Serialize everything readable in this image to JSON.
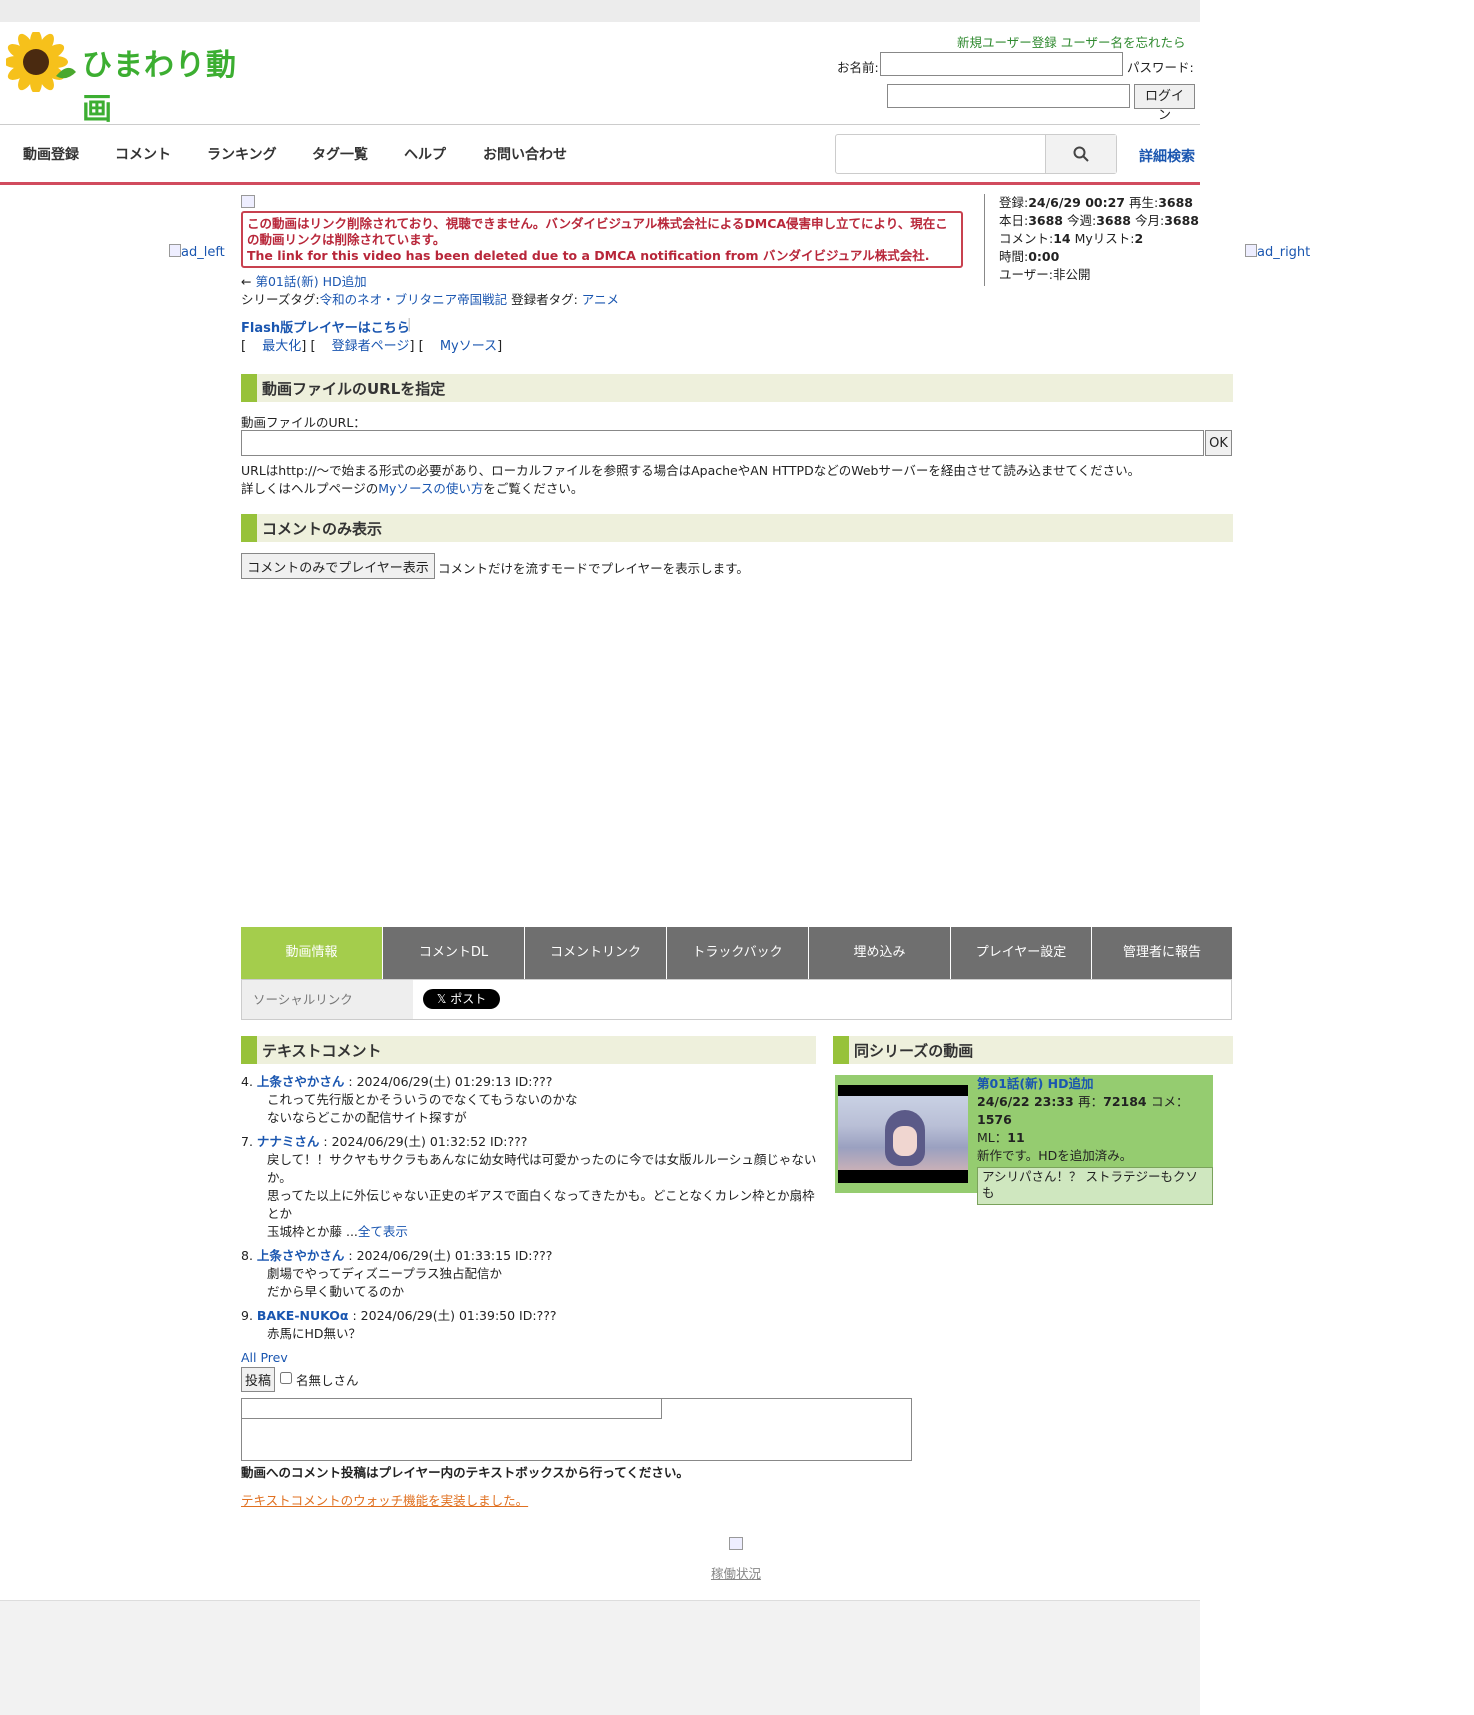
{
  "site": {
    "logo_text": "ひまわり動画"
  },
  "header": {
    "register_link": "新規ユーザー登録",
    "forgot_link": "ユーザー名を忘れたら",
    "name_label": "お名前:",
    "password_label": "パスワード:",
    "login_button": "ログイン"
  },
  "nav": {
    "items": [
      "動画登録",
      "コメント",
      "ランキング",
      "タグ一覧",
      "ヘルプ",
      "お問い合わせ"
    ],
    "detail_search": "詳細検索"
  },
  "ads": {
    "left": "ad_left",
    "right": "ad_right"
  },
  "warning": {
    "ja": "この動画はリンク削除されており、視聴できません。バンダイビジュアル株式会社によるDMCA侵害申し立てにより、現在この動画リンクは削除されています。",
    "en": "The link for this video has been deleted due to a DMCA notification from バンダイビジュアル株式会社."
  },
  "video": {
    "prev_arrow": "←",
    "prev_link": "第01話(新) HD追加",
    "series_tag_label": "シリーズタグ:",
    "series_tag": "令和のネオ・ブリタニア帝国戦記",
    "user_tag_label": "登録者タグ:",
    "user_tag": "アニメ",
    "flash_link": "Flash版プレイヤーはこちら",
    "maximize": "最大化",
    "uploader_page": "登録者ページ",
    "my_source": "Myソース"
  },
  "stats": {
    "registered_label": "登録:",
    "registered": "24/6/29 00:27",
    "plays_label": "再生:",
    "plays": "3688",
    "today_label": "本日:",
    "today": "3688",
    "week_label": "今週:",
    "week": "3688",
    "month_label": "今月:",
    "month": "3688",
    "comments_label": "コメント:",
    "comments": "14",
    "mylist_label": "Myリスト:",
    "mylist": "2",
    "time_label": "時間:",
    "time": "0:00",
    "user_label": "ユーザー:非公開"
  },
  "url_section": {
    "title": "動画ファイルのURLを指定",
    "field_label": "動画ファイルのURL：",
    "ok": "OK",
    "note1": "URLはhttp://〜で始まる形式の必要があり、ローカルファイルを参照する場合はApacheやAN HTTPDなどのWebサーバーを経由させて読み込ませてください。",
    "note2_pre": "詳しくはヘルプページの",
    "note2_link": "Myソースの使い方",
    "note2_post": "をご覧ください。"
  },
  "comment_only": {
    "title": "コメントのみ表示",
    "button": "コメントのみでプレイヤー表示",
    "desc": "コメントだけを流すモードでプレイヤーを表示します。"
  },
  "tabs": [
    "動画情報",
    "コメントDL",
    "コメントリンク",
    "トラックバック",
    "埋め込み",
    "プレイヤー設定",
    "管理者に報告"
  ],
  "social": {
    "label": "ソーシャルリンク",
    "x_post": "𝕏 ポスト"
  },
  "text_comments": {
    "title": "テキストコメント",
    "items": [
      {
        "num": "4.",
        "name": "上条さやかさん",
        "meta": ": 2024/06/29(土) 01:29:13 ID:???",
        "lines": [
          "これって先行版とかそういうのでなくてもうないのかな",
          "ないならどこかの配信サイト探すが"
        ]
      },
      {
        "num": "7.",
        "name": "ナナミさん",
        "meta": ": 2024/06/29(土) 01:32:52 ID:???",
        "lines": [
          "戻して！！サクヤもサクラもあんなに幼女時代は可愛かったのに今では女版ルルーシュ顔じゃないか。",
          "思ってた以上に外伝じゃない正史のギアスで面白くなってきたかも。どことなくカレン枠とか扇枠とか"
        ],
        "last_line": "玉城枠とか藤 ...",
        "show_all": "全て表示"
      },
      {
        "num": "8.",
        "name": "上条さやかさん",
        "meta": ": 2024/06/29(土) 01:33:15 ID:???",
        "lines": [
          "劇場でやってディズニープラス独占配信か",
          "だから早く動いてるのか"
        ]
      },
      {
        "num": "9.",
        "name": "BAKE-NUKOα",
        "meta": ": 2024/06/29(土) 01:39:50 ID:???",
        "lines": [
          "赤馬にHD無い？"
        ]
      }
    ],
    "all": "All",
    "prev": "Prev",
    "post_button": "投稿",
    "anon_label": "名無しさん",
    "note": "動画へのコメント投稿はプレイヤー内のテキストボックスから行ってください。",
    "watch_link": "テキストコメントのウォッチ機能を実装しました。"
  },
  "series": {
    "title": "同シリーズの動画",
    "item_title": "第01話(新) HD追加",
    "date": "24/6/22 23:33",
    "plays_label": "再：",
    "plays": "72184",
    "comments_label": "コメ：",
    "comments": "1576",
    "ml_label": "ML：",
    "ml": "11",
    "desc": "新作です。HDを追加済み。",
    "latest_comment": "アシリパさん！？ ストラテジーもクソも"
  },
  "footer": {
    "status_link": "稼働状況"
  },
  "colors": {
    "accent_green": "#97c23a",
    "nav_red": "#d14b5e",
    "warn_red": "#b8273a",
    "link_blue": "#1a56b0"
  }
}
